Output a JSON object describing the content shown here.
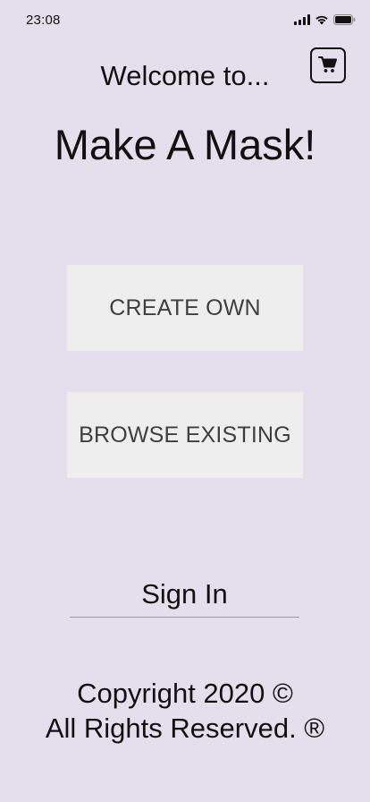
{
  "status_bar": {
    "time": "23:08",
    "icons": [
      "cellular-signal-icon",
      "wifi-icon",
      "battery-icon"
    ]
  },
  "header": {
    "welcome_text": "Welcome to...",
    "app_title": "Make A Mask!",
    "cart_icon": "shopping-cart-icon"
  },
  "menu": {
    "create_label": "CREATE OWN",
    "browse_label": "BROWSE EXISTING"
  },
  "auth": {
    "sign_in_label": "Sign In"
  },
  "footer": {
    "line1": "Copyright 2020 ©",
    "line2": "All Rights Reserved. ®"
  },
  "colors": {
    "background": "#e3dfec",
    "button_bg": "#eeeeee",
    "button_text": "#3f3f3f",
    "text": "#111111"
  }
}
